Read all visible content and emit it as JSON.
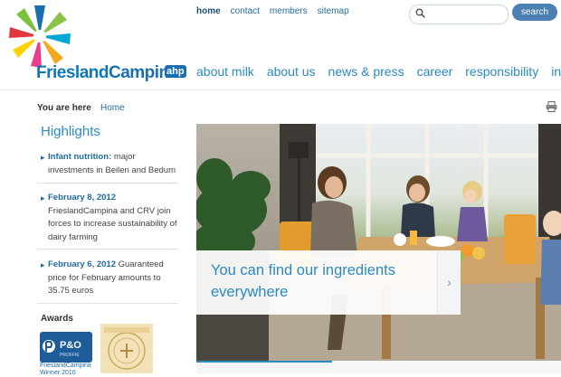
{
  "brand": {
    "name_part1": "Friesland",
    "name_part2": "Campina",
    "badge": "ahp"
  },
  "toplinks": [
    {
      "label": "home"
    },
    {
      "label": "contact"
    },
    {
      "label": "members"
    },
    {
      "label": "sitemap"
    }
  ],
  "search": {
    "placeholder": "",
    "button_label": "search"
  },
  "mainnav": [
    {
      "label": "about milk"
    },
    {
      "label": "about us"
    },
    {
      "label": "news & press"
    },
    {
      "label": "career"
    },
    {
      "label": "responsibility"
    },
    {
      "label": "innova"
    }
  ],
  "breadcrumb": {
    "label": "You are here",
    "home": "Home"
  },
  "highlights": {
    "title": "Highlights",
    "items": [
      {
        "bold": "Infant nutrition:",
        "text": " major investments in Beilen and Bedum"
      },
      {
        "bold": "February 8, 2012",
        "text": "FrieslandCampina and CRV join forces to increase sustainability of dairy farming"
      },
      {
        "bold": "February 6, 2012",
        "text": " Guaranteed price for February amounts to 35.75 euros"
      }
    ]
  },
  "awards": {
    "title": "Awards",
    "po_badge": "P&O",
    "po_sub": "PROFFIE",
    "po_caption_line1": "FrieslandCampina",
    "po_caption_line2": "Winner 2010"
  },
  "hero": {
    "caption": "You can find our ingredients everywhere",
    "arrow": "›"
  },
  "colors": {
    "link": "#1f6b9e",
    "accent": "#2b8ac0",
    "search_button": "#4c7fb2"
  }
}
